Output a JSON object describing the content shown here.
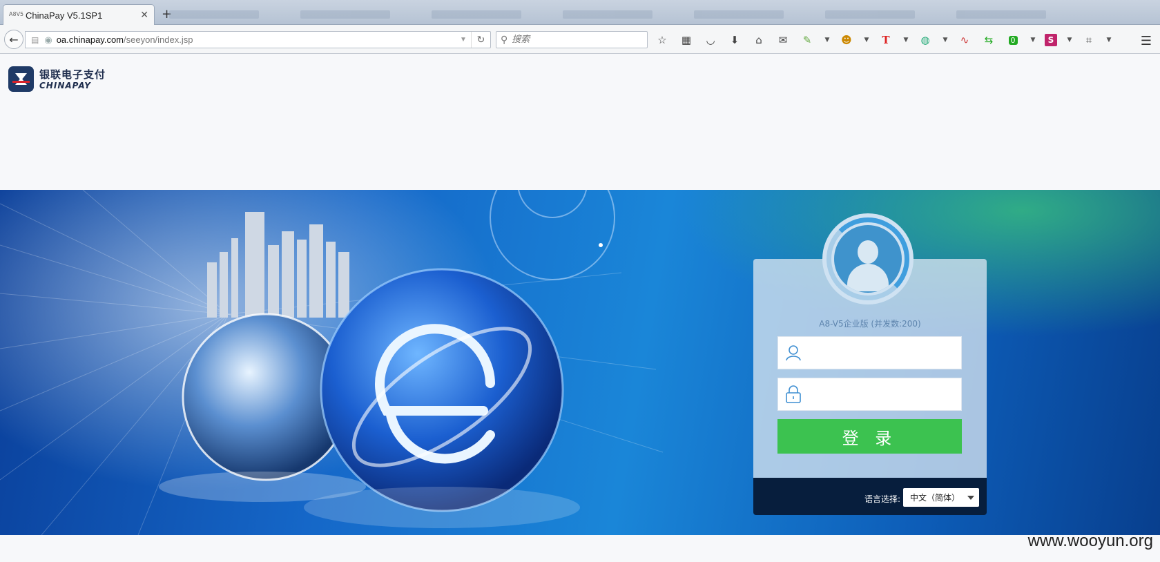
{
  "browser": {
    "tab_title": "ChinaPay V5.1SP1",
    "tab_favicon": "A8V5",
    "new_tab": "+",
    "url_domain": "oa.chinapay.com",
    "url_path": "/seeyon/index.jsp",
    "search_placeholder": "搜索",
    "toolbar_icons": [
      "bookmark-star-icon",
      "reading-list-icon",
      "pocket-icon",
      "download-icon",
      "home-icon",
      "chat-icon",
      "addon-icon",
      "addon-dropdown-icon",
      "monkey-icon",
      "monkey-dropdown-icon",
      "text-t-icon",
      "text-dropdown-icon",
      "globe-icon",
      "globe-dropdown-icon",
      "stats-icon",
      "sync-icon",
      "counter-icon",
      "counter-dropdown-icon",
      "s-icon",
      "s-dropdown-icon",
      "crop-icon",
      "crop-dropdown-icon"
    ],
    "counter_badge": "0"
  },
  "brand": {
    "name_cn": "银联电子支付",
    "name_en": "CHINAPAY",
    "primary_color": "#1f3a66",
    "accent_color": "#d8232a"
  },
  "login": {
    "edition": "A8-V5企业版 (并发数:200)",
    "username_value": "",
    "password_value": "",
    "submit_label": "登 录",
    "submit_color": "#3cc250",
    "language_label": "语言选择:",
    "language_selected": "中文（简体）"
  },
  "watermark": "www.wooyun.org"
}
